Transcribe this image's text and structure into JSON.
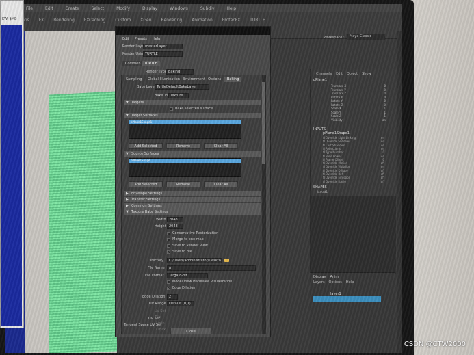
{
  "app": {
    "menubar": [
      "File",
      "Edit",
      "Create",
      "Select",
      "Modify",
      "Display",
      "Windows",
      "Subdiv",
      "Help"
    ],
    "shelf_tabs": [
      "Polygons",
      "FX",
      "Rendering",
      "FXCaching",
      "Custom",
      "XGen",
      "Rendering",
      "Animation",
      "ProtecFX",
      "TURTLE"
    ],
    "workspace_label": "Workspace :",
    "workspace_value": "Maya Classic"
  },
  "background_window": {
    "label": "EW_$MB"
  },
  "dialog": {
    "menu": [
      "Edit",
      "Presets",
      "Help"
    ],
    "render_layer_label": "Render Layer",
    "render_layer_value": "masterLayer",
    "render_using_label": "Render Using",
    "render_using_value": "TURTLE",
    "tabs": [
      "Common",
      "TURTLE"
    ],
    "render_type_label": "Render Type",
    "render_type_value": "Baking",
    "subtabs": [
      "Sampling",
      "Global Illumination",
      "Environment",
      "Options",
      "Baking"
    ],
    "bake_layer_label": "Bake Layer",
    "bake_layer_value": "TurtleDefaultBakeLayer",
    "bake_to_label": "Bake To",
    "bake_to_value": "Texture",
    "section_targets": "Targets",
    "bake_selected_label": "Bake selected surface",
    "section_target_surfaces": "Target Surfaces",
    "target_item": "pPlane1Shape1",
    "target_buttons": [
      "Add Selected",
      "Remove",
      "Clear All"
    ],
    "section_source_surfaces": "Source Surfaces",
    "source_item": "pPlane1Shape",
    "source_buttons": [
      "Add Selected",
      "Remove",
      "Clear All"
    ],
    "collapsed_sections": [
      "Envelope Settings",
      "Transfer Settings",
      "Common Settings"
    ],
    "section_output": "Texture Bake Settings",
    "width_label": "Width",
    "width_value": "2048",
    "height_label": "Height",
    "height_value": "2048",
    "checks": [
      {
        "label": "Conservative Rasterization",
        "checked": false
      },
      {
        "label": "Merge to one map",
        "checked": false
      },
      {
        "label": "Save to Render View",
        "checked": false
      },
      {
        "label": "Save to File",
        "checked": true
      }
    ],
    "directory_label": "Directory",
    "directory_value": "C:/Users/Administrator/Desktop/",
    "file_name_label": "File Name",
    "file_name_value": "a",
    "file_format_label": "File Format",
    "file_format_value": "Targa 8-bit",
    "check_hw_label": "Model View Hardware Visualization",
    "check_edge_label": "Edge Dilation",
    "check_edge_checked": true,
    "edge_dilation_label": "Edge Dilation",
    "edge_dilation_value": "2",
    "uv_range_label": "UV Range",
    "uv_range_value": "Default (0,1)",
    "uv_fields": [
      "Uv Set",
      "Tile",
      "U min",
      "U max"
    ],
    "uv_set_label": "UV Set",
    "tangent_label": "Tangent Space UV Set",
    "close_label": "Close"
  },
  "channel_box": {
    "menu": [
      "Channels",
      "Edit",
      "Object",
      "Show"
    ],
    "object": "pPlane1",
    "rows": [
      {
        "name": "Translate X",
        "value": "0"
      },
      {
        "name": "Translate Y",
        "value": "0"
      },
      {
        "name": "Translate Z",
        "value": "0"
      },
      {
        "name": "Rotate X",
        "value": "0"
      },
      {
        "name": "Rotate Y",
        "value": "0"
      },
      {
        "name": "Rotate Z",
        "value": "0"
      },
      {
        "name": "Scale X",
        "value": "1"
      },
      {
        "name": "Scale Y",
        "value": "1"
      },
      {
        "name": "Scale Z",
        "value": "1"
      },
      {
        "name": "Visibility",
        "value": "on"
      }
    ],
    "inputs_title": "INPUTS",
    "inputs_object": "pPlane1Shape1",
    "inputs_rows": [
      {
        "name": "tl Override Light Linking",
        "value": "on"
      },
      {
        "name": "tl Override Shadows",
        "value": "on"
      },
      {
        "name": "tl Cast Shadows",
        "value": "on"
      },
      {
        "name": "tl Reflections",
        "value": "on"
      },
      {
        "name": "tl Type Number",
        "value": "0"
      },
      {
        "name": "tl Bake Power",
        "value": "on"
      },
      {
        "name": "tl Frame Offset",
        "value": "0"
      },
      {
        "name": "tl Override Motion",
        "value": "off"
      },
      {
        "name": "tl Override Visibility",
        "value": "on"
      },
      {
        "name": "tl Override Diffuse",
        "value": "off"
      },
      {
        "name": "tl Override Refl",
        "value": "off"
      },
      {
        "name": "tl Override Emission",
        "value": "off"
      },
      {
        "name": "tl Override Radio",
        "value": "off"
      }
    ],
    "shapes_title": "SHAPES",
    "shapes_item": "lamad1"
  },
  "layer_editor": {
    "tabs": [
      "Display",
      "Anim"
    ],
    "menu": [
      "Layers",
      "Options",
      "Help"
    ],
    "layer_name": "layer1"
  },
  "watermark": "CSDN @CTW2000"
}
